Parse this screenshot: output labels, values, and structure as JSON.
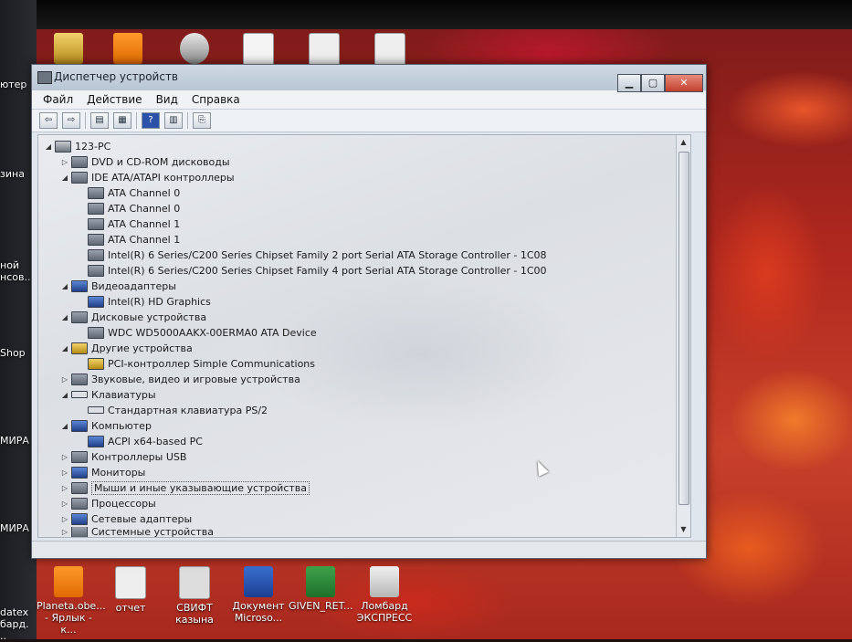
{
  "window": {
    "title": "Диспетчер устройств",
    "controls": {
      "minimize": "▁",
      "maximize": "▢",
      "close": "✕"
    }
  },
  "menu": [
    "Файл",
    "Действие",
    "Вид",
    "Справка"
  ],
  "toolbar": {
    "back": "⇦",
    "forward": "⇨",
    "properties": "▤",
    "window": "▦",
    "help": "?",
    "list": "▥",
    "scan": "⎘"
  },
  "tree": {
    "root": "123-PC",
    "nodes": [
      {
        "label": "DVD и CD-ROM дисководы",
        "state": "collapsed"
      },
      {
        "label": "IDE ATA/ATAPI контроллеры",
        "state": "expanded",
        "children": [
          "ATA Channel 0",
          "ATA Channel 0",
          "ATA Channel 1",
          "ATA Channel 1",
          "Intel(R) 6 Series/C200 Series Chipset Family 2 port Serial ATA Storage Controller - 1C08",
          "Intel(R) 6 Series/C200 Series Chipset Family 4 port Serial ATA Storage Controller - 1C00"
        ]
      },
      {
        "label": "Видеоадаптеры",
        "state": "expanded",
        "children": [
          "Intel(R) HD Graphics"
        ]
      },
      {
        "label": "Дисковые устройства",
        "state": "expanded",
        "children": [
          "WDC WD5000AAKX-00ERMA0 ATA Device"
        ]
      },
      {
        "label": "Другие устройства",
        "state": "expanded",
        "children": [
          "PCI-контроллер Simple Communications"
        ]
      },
      {
        "label": "Звуковые, видео и игровые устройства",
        "state": "collapsed"
      },
      {
        "label": "Клавиатуры",
        "state": "expanded",
        "children": [
          "Стандартная клавиатура PS/2"
        ]
      },
      {
        "label": "Компьютер",
        "state": "expanded",
        "children": [
          "ACPI x64-based PC"
        ]
      },
      {
        "label": "Контроллеры USB",
        "state": "collapsed"
      },
      {
        "label": "Мониторы",
        "state": "collapsed"
      },
      {
        "label": "Мыши и иные указывающие устройства",
        "state": "collapsed",
        "selected": true
      },
      {
        "label": "Процессоры",
        "state": "collapsed"
      },
      {
        "label": "Сетевые адаптеры",
        "state": "collapsed"
      },
      {
        "label": "Системные устройства",
        "state": "collapsed"
      }
    ]
  },
  "desktop_icons": [
    {
      "label": "отчет"
    },
    {
      "label": "СВИФТ казына"
    },
    {
      "label": "Документ Microso..."
    },
    {
      "label": "GIVEN_RET..."
    },
    {
      "label": "Ломбард ЭКСПРЕСС"
    },
    {
      "label": "Planeta.obe... - Ярлык - к..."
    }
  ],
  "left_labels": [
    "ютер",
    "зина",
    "ной нсов...",
    "Shop",
    "МИРА",
    "МИРА",
    "datex бард. .."
  ]
}
